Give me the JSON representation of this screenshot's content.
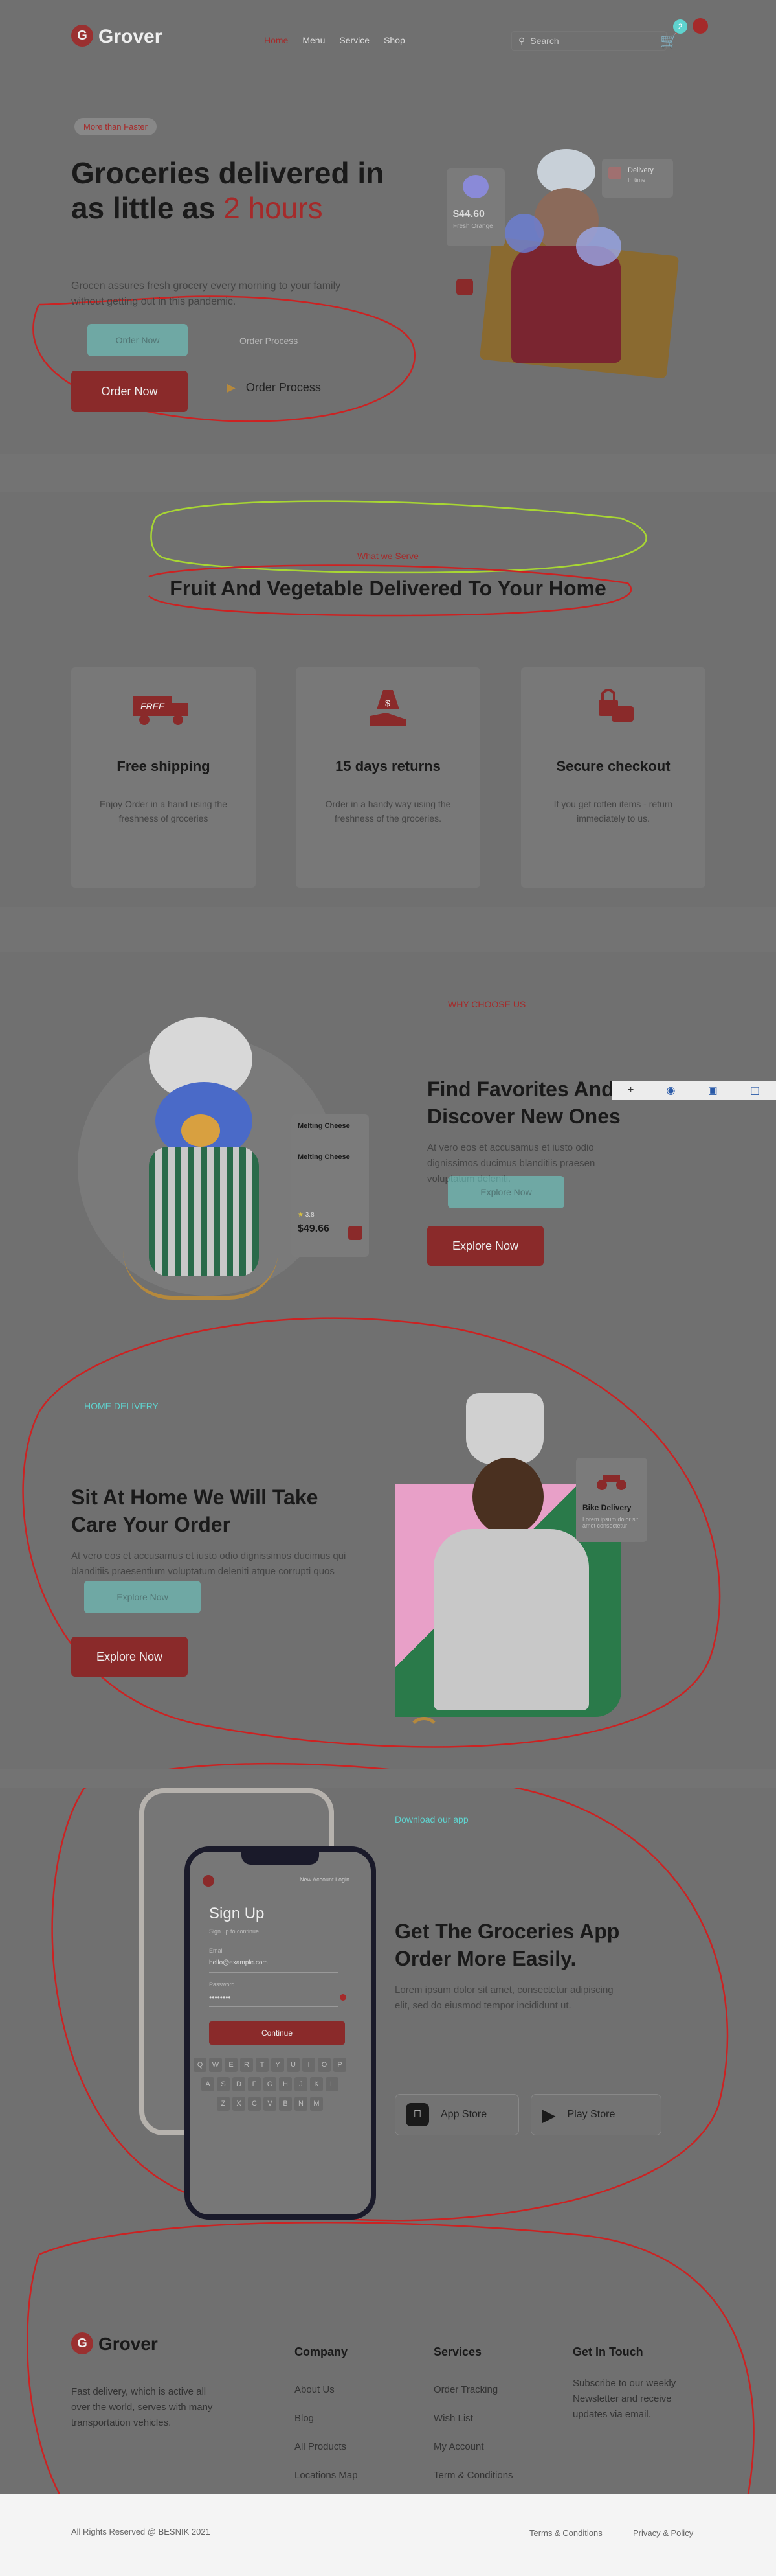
{
  "brand": {
    "name": "Grover",
    "logo_letter": "G",
    "accent": "#a52a2a",
    "teal": "#5fd3cf"
  },
  "nav": {
    "links": [
      "Home",
      "Menu",
      "Service",
      "Shop"
    ],
    "search_label": "Search",
    "cart_count": "2"
  },
  "hero": {
    "badge": "More than Faster",
    "title_1": "Groceries delivered in",
    "title_2": "as little as",
    "title_accent": "2 hours",
    "description": "Grocen assures fresh grocery every morning to your family without getting out in this pandemic.",
    "order_button": "Order Now",
    "process_button": "Order Process",
    "product_price": "$44.60",
    "product_name": "Fresh Orange",
    "delivery_label": "Delivery",
    "delivery_sub": "In time"
  },
  "serve": {
    "eyebrow": "What we Serve",
    "title": "Fruit And Vegetable Delivered To Your Home",
    "cards": [
      {
        "icon": "free-truck-icon",
        "badge": "FREE",
        "title": "Free shipping",
        "text": "Enjoy Order in a hand using the freshness of groceries"
      },
      {
        "icon": "money-hand-icon",
        "title": "15 days returns",
        "text": "Order in a handy way using the freshness of the groceries."
      },
      {
        "icon": "lock-chat-icon",
        "title": "Secure checkout",
        "text": "If you get rotten items - return immediately to us."
      }
    ]
  },
  "choose": {
    "eyebrow": "WHY CHOOSE US",
    "title_1": "Find Favorites And",
    "title_2": "Discover New Ones",
    "text": "At vero eos et accusamus et iusto odio dignissimos ducimus blanditiis praesen voluptatum deleniti.",
    "button": "Explore Now",
    "product_name": "Melting Cheese",
    "product_sub": "Melting Cheese",
    "rating": "3.8",
    "price": "$49.66"
  },
  "home_delivery": {
    "eyebrow": "HOME DELIVERY",
    "title_1": "Sit At Home We Will Take",
    "title_2": "Care Your Order",
    "text": "At vero eos et accusamus et iusto odio dignissimos ducimus qui blanditiis praesentium voluptatum deleniti atque corrupti quos",
    "button": "Explore Now",
    "bike_label": "Bike Delivery",
    "bike_text": "Lorem ipsum dolor sit amet consectetur"
  },
  "app": {
    "eyebrow": "Download our app",
    "title_1": "Get The Groceries App",
    "title_2": "Order More Easily.",
    "text": "Lorem ipsum dolor sit amet, consectetur adipiscing elit, sed do eiusmod tempor incididunt ut.",
    "app_store": "App Store",
    "play_store": "Play Store",
    "phone": {
      "header": "New Account Login",
      "title": "Sign Up",
      "sub": "Sign up to continue",
      "email_label": "Email",
      "email_value": "hello@example.com",
      "password_label": "Password",
      "password_value": "••••••••",
      "button": "Continue",
      "keys_row1": [
        "Q",
        "W",
        "E",
        "R",
        "T",
        "Y",
        "U",
        "I",
        "O",
        "P"
      ],
      "keys_row2": [
        "A",
        "S",
        "D",
        "F",
        "G",
        "H",
        "J",
        "K",
        "L"
      ],
      "keys_row3": [
        "Z",
        "X",
        "C",
        "V",
        "B",
        "N",
        "M"
      ]
    }
  },
  "footer": {
    "about": "Fast delivery, which is active all over the world, serves with many transportation vehicles.",
    "company_title": "Company",
    "company_links": [
      "About Us",
      "Blog",
      "All Products",
      "Locations Map"
    ],
    "services_title": "Services",
    "services_links": [
      "Order Tracking",
      "Wish List",
      "My Account",
      "Term & Conditions"
    ],
    "touch_title": "Get In Touch",
    "touch_text": "Subscribe to our weekly Newsletter and receive updates via email.",
    "copyright": "All Rights Reserved @ BESNIK 2021",
    "terms": "Terms & Conditions",
    "privacy": "Privacy & Policy"
  }
}
